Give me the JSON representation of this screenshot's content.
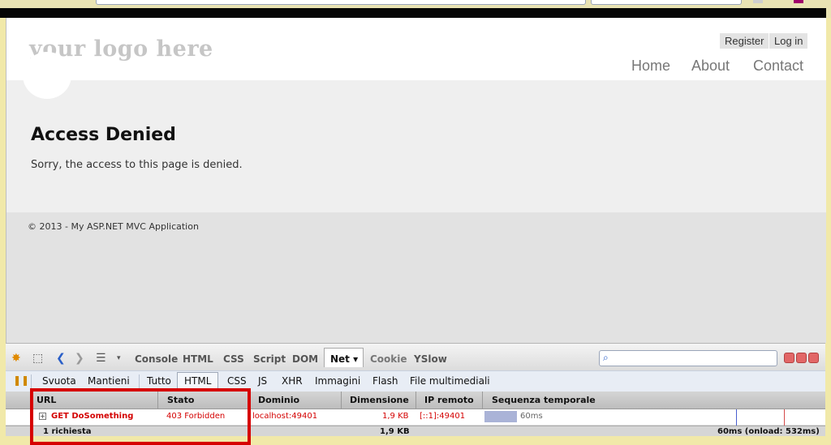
{
  "site": {
    "logo_text": "your logo here",
    "auth_links": [
      "Register",
      "Log in"
    ],
    "nav": [
      "Home",
      "About",
      "Contact"
    ],
    "page_title": "Access Denied",
    "message": "Sorry, the access to this page is denied.",
    "footer_text": "© 2013 - My ASP.NET MVC Application"
  },
  "firebug": {
    "panels": [
      "Console",
      "HTML",
      "CSS",
      "Script",
      "DOM",
      "Net",
      "Cookie",
      "YSlow"
    ],
    "active_panel": "Net",
    "net_filters": [
      "Svuota",
      "Mantieni",
      "Tutto",
      "HTML",
      "CSS",
      "JS",
      "XHR",
      "Immagini",
      "Flash",
      "File multimediali"
    ],
    "active_filter": "HTML",
    "columns": [
      "URL",
      "Stato",
      "Dominio",
      "Dimensione",
      "IP remoto",
      "Sequenza temporale"
    ],
    "rows": [
      {
        "url": "GET DoSomething",
        "status": "403 Forbidden",
        "domain": "localhost:49401",
        "size": "1,9 KB",
        "remote_ip": "[::1]:49401",
        "timing": "60ms"
      }
    ],
    "summary": {
      "requests": "1 richiesta",
      "total_size": "1,9 KB",
      "total_time": "60ms (onload: 532ms)"
    }
  },
  "colors": {
    "error_text": "#d40000",
    "highlight_box": "#d60000",
    "timeline_bar": "#aab3d7"
  }
}
